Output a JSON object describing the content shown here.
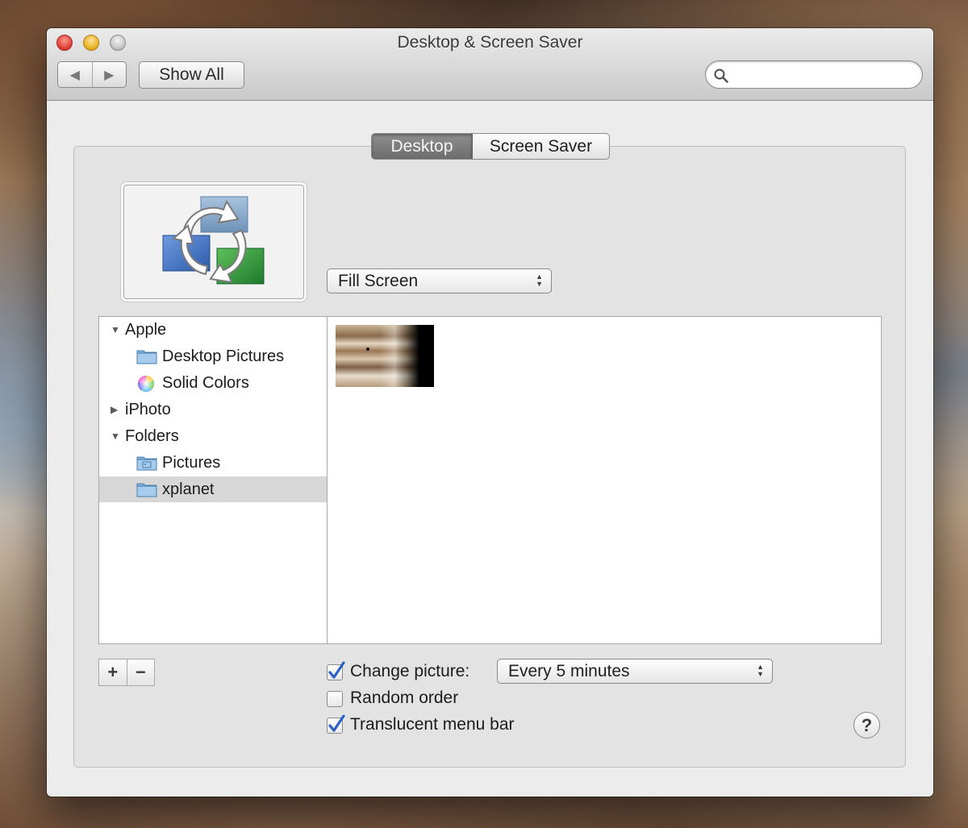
{
  "window": {
    "title": "Desktop & Screen Saver"
  },
  "toolbar": {
    "back_icon": "back-arrow-icon",
    "forward_icon": "forward-arrow-icon",
    "back_glyph": "◀",
    "forward_glyph": "▶",
    "show_all_label": "Show All",
    "search": {
      "value": "",
      "placeholder": ""
    }
  },
  "tabs": [
    {
      "label": "Desktop",
      "selected": true
    },
    {
      "label": "Screen Saver",
      "selected": false
    }
  ],
  "preview": {
    "icon": "rotating-pictures-icon"
  },
  "scaling": {
    "value": "Fill Screen"
  },
  "sources": [
    {
      "label": "Apple",
      "type": "group",
      "expanded": true
    },
    {
      "label": "Desktop Pictures",
      "type": "item",
      "icon": "folder-icon"
    },
    {
      "label": "Solid Colors",
      "type": "item",
      "icon": "color-wheel-icon"
    },
    {
      "label": "iPhoto",
      "type": "group",
      "expanded": false
    },
    {
      "label": "Folders",
      "type": "group",
      "expanded": true
    },
    {
      "label": "Pictures",
      "type": "item",
      "icon": "pictures-folder-icon"
    },
    {
      "label": "xplanet",
      "type": "item",
      "icon": "folder-icon",
      "selected": true
    }
  ],
  "disclosure": {
    "expanded": "▼",
    "collapsed": "▶"
  },
  "images": [
    {
      "name": "jupiter-thumbnail"
    }
  ],
  "list_buttons": {
    "add": "+",
    "remove": "−"
  },
  "options": {
    "change_picture": {
      "label": "Change picture:",
      "checked": true
    },
    "interval": {
      "value": "Every 5 minutes"
    },
    "random_order": {
      "label": "Random order",
      "checked": false
    },
    "translucent_menu_bar": {
      "label": "Translucent menu bar",
      "checked": true
    }
  },
  "help": {
    "label": "?"
  },
  "colors": {
    "checkmark": "#2a61c2",
    "folder": "#7fb0dc",
    "selected_row": "#d7d7d7",
    "selected_tab": "#7c7c7c"
  }
}
